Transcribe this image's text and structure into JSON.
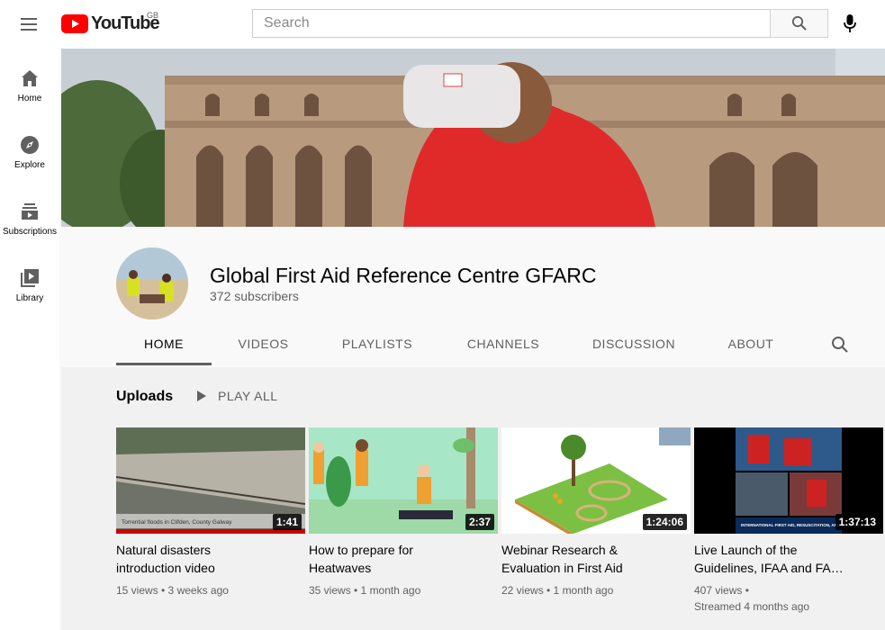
{
  "topbar": {
    "logo_text": "YouTube",
    "region": "GB",
    "search_placeholder": "Search"
  },
  "sidebar": {
    "items": [
      {
        "label": "Home",
        "icon": "home-icon"
      },
      {
        "label": "Explore",
        "icon": "compass-icon"
      },
      {
        "label": "Subscriptions",
        "icon": "subscriptions-icon"
      },
      {
        "label": "Library",
        "icon": "library-icon"
      }
    ]
  },
  "channel": {
    "title": "Global First Aid Reference Centre GFARC",
    "subscribers": "372 subscribers",
    "tabs": [
      {
        "label": "HOME",
        "active": true
      },
      {
        "label": "VIDEOS"
      },
      {
        "label": "PLAYLISTS"
      },
      {
        "label": "CHANNELS"
      },
      {
        "label": "DISCUSSION"
      },
      {
        "label": "ABOUT"
      }
    ]
  },
  "shelf": {
    "title": "Uploads",
    "play_all": "PLAY ALL"
  },
  "videos": [
    {
      "title_line1": "Natural disasters",
      "title_line2": "introduction video",
      "duration": "1:41",
      "meta1": "15 views • 3 weeks ago",
      "meta2": "",
      "thumb_caption": "Torrential floods in Clifden, County Galway",
      "watched_fraction": 1.0
    },
    {
      "title_line1": "How to prepare for",
      "title_line2": "Heatwaves",
      "duration": "2:37",
      "meta1": "35 views • 1 month ago",
      "meta2": ""
    },
    {
      "title_line1": "Webinar Research &",
      "title_line2": "Evaluation in First Aid",
      "duration": "1:24:06",
      "meta1": "22 views • 1 month ago",
      "meta2": ""
    },
    {
      "title_line1": "Live Launch of the",
      "title_line2": "Guidelines, IFAA and FA…",
      "duration": "1:37:13",
      "meta1": "407 views •",
      "meta2": "Streamed 4 months ago",
      "thumb_caption": "INTERNATIONAL FIRST AID, RESUSCITATION, AND EDUCATION"
    }
  ],
  "colors": {
    "brand_red": "#ff0000",
    "shirt_red": "#e02a2a",
    "progress_red": "#cc0000"
  }
}
